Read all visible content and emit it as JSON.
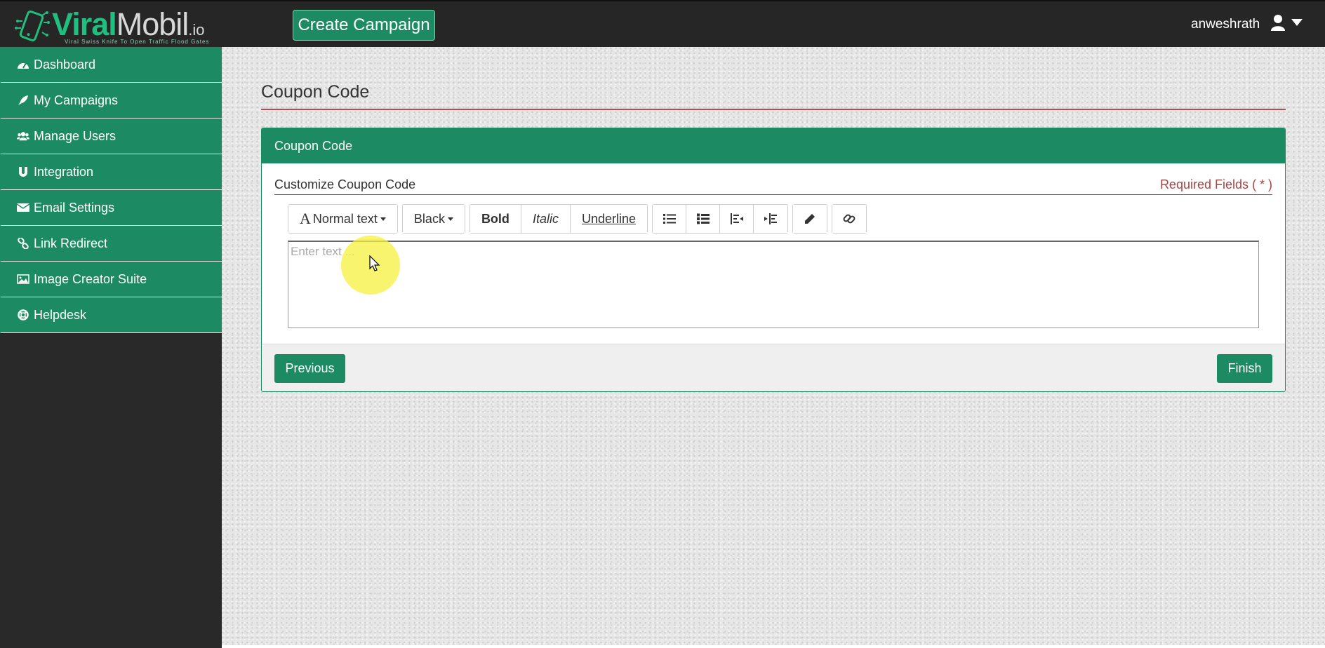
{
  "header": {
    "logo_text_viral": "Viral",
    "logo_text_mobil": "Mobil",
    "logo_text_io": ".io",
    "logo_tagline": "Viral Swiss Knife To Open Traffic Flood Gates",
    "create_campaign_label": "Create Campaign",
    "username": "anweshrath",
    "user_icon": "user-icon",
    "dropdown_icon": "caret-down-icon"
  },
  "sidebar": {
    "items": [
      {
        "label": "Dashboard",
        "icon": "dashboard-icon"
      },
      {
        "label": "My Campaigns",
        "icon": "rocket-icon"
      },
      {
        "label": "Manage Users",
        "icon": "users-icon"
      },
      {
        "label": "Integration",
        "icon": "magnet-icon"
      },
      {
        "label": "Email Settings",
        "icon": "envelope-icon"
      },
      {
        "label": "Link Redirect",
        "icon": "link-icon"
      },
      {
        "label": "Image Creator Suite",
        "icon": "image-icon"
      },
      {
        "label": "Helpdesk",
        "icon": "lifebuoy-icon"
      }
    ]
  },
  "main": {
    "page_title": "Coupon Code",
    "panel_title": "Coupon Code",
    "customize_label": "Customize Coupon Code",
    "required_label": "Required Fields ( * )",
    "toolbar": {
      "text_style": "Normal text",
      "color": "Black",
      "bold": "Bold",
      "italic": "Italic",
      "underline": "Underline"
    },
    "editor_placeholder": "Enter text ...",
    "previous_label": "Previous",
    "finish_label": "Finish"
  },
  "colors": {
    "brand_green": "#1c8a63",
    "topbar_dark": "#262626",
    "required_red": "#a94442",
    "cursor_highlight": "#f6f03c"
  }
}
